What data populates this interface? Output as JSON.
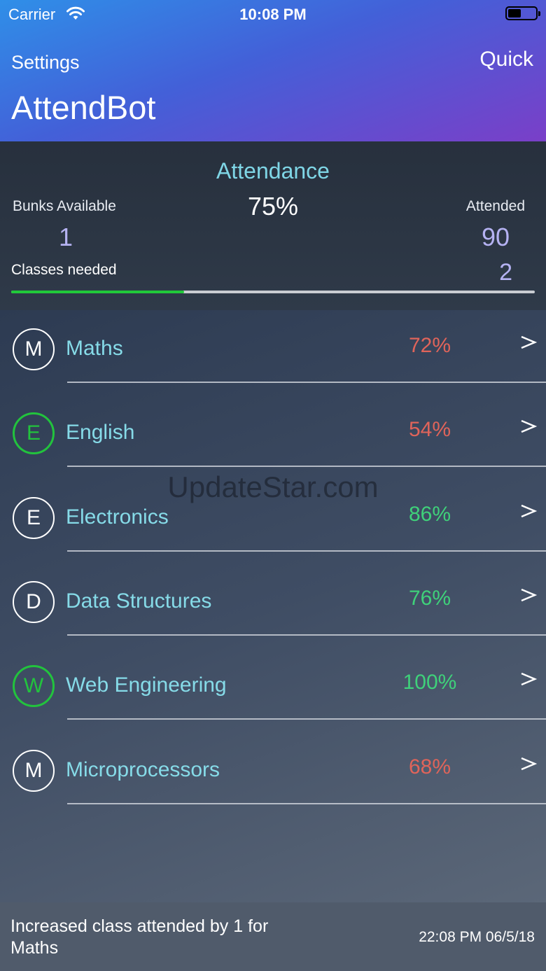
{
  "status_bar": {
    "carrier": "Carrier",
    "time": "10:08 PM",
    "wifi_icon": "wifi-icon",
    "battery_icon": "battery-icon"
  },
  "nav": {
    "left_label": "Settings",
    "right_label": "Quick",
    "title": "AttendBot"
  },
  "stats": {
    "attendance_label": "Attendance",
    "attendance_value": "75%",
    "bunks_label": "Bunks Available",
    "bunks_value": "1",
    "attended_label": "Attended",
    "attended_value": "90",
    "needed_label": "Classes needed",
    "needed_value": "2",
    "progress_fraction": 0.33
  },
  "subjects": [
    {
      "letter": "M",
      "name": "Maths",
      "percent": "72%",
      "status": "low"
    },
    {
      "letter": "E",
      "name": "English",
      "percent": "54%",
      "status": "low",
      "ring": "green"
    },
    {
      "letter": "E",
      "name": "Electronics",
      "percent": "86%",
      "status": "good"
    },
    {
      "letter": "D",
      "name": "Data Structures",
      "percent": "76%",
      "status": "good"
    },
    {
      "letter": "W",
      "name": "Web Engineering",
      "percent": "100%",
      "status": "good",
      "ring": "green"
    },
    {
      "letter": "M",
      "name": "Microprocessors",
      "percent": "68%",
      "status": "low"
    }
  ],
  "colors": {
    "low": "#e0645a",
    "good": "#3fd17a",
    "ring_green": "#22c33d",
    "accent": "#86dbe8"
  },
  "watermark": "UpdateStar.com",
  "footer": {
    "message": "Increased class attended by 1 for Maths",
    "timestamp": "22:08 PM 06/5/18"
  }
}
